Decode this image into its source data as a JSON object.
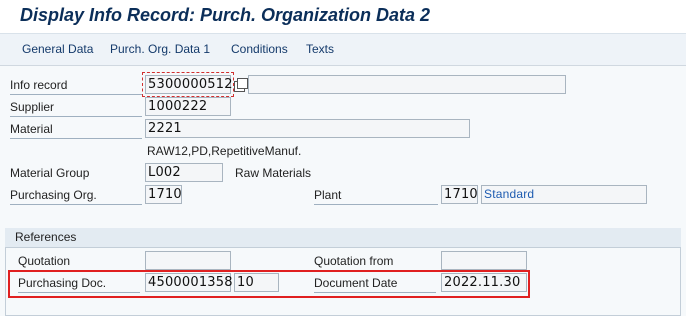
{
  "title": "Display Info Record: Purch. Organization Data 2",
  "tabs": [
    {
      "label": "General Data"
    },
    {
      "label": "Purch. Org. Data 1"
    },
    {
      "label": "Conditions"
    },
    {
      "label": "Texts"
    }
  ],
  "header": {
    "info_record_label": "Info record",
    "info_record_value": "5300000512",
    "supplier_label": "Supplier",
    "supplier_value": "1000222",
    "material_label": "Material",
    "material_value": "2221",
    "material_desc": "RAW12,PD,RepetitiveManuf.",
    "material_group_label": "Material Group",
    "material_group_value": "L002",
    "material_group_desc": "Raw Materials",
    "purch_org_label": "Purchasing Org.",
    "purch_org_value": "1710",
    "plant_label": "Plant",
    "plant_value": "1710",
    "plant_desc": "Standard"
  },
  "references": {
    "title": "References",
    "quotation_label": "Quotation",
    "quotation_value": "",
    "quotation_from_label": "Quotation from",
    "quotation_from_value": "",
    "purchasing_doc_label": "Purchasing Doc.",
    "purchasing_doc_value": "4500001358",
    "purchasing_doc_item": "10",
    "document_date_label": "Document Date",
    "document_date_value": "2022.11.30"
  },
  "colors": {
    "title": "#0b2e59",
    "highlight": "#e02020",
    "link_text": "#1d5bb0"
  }
}
